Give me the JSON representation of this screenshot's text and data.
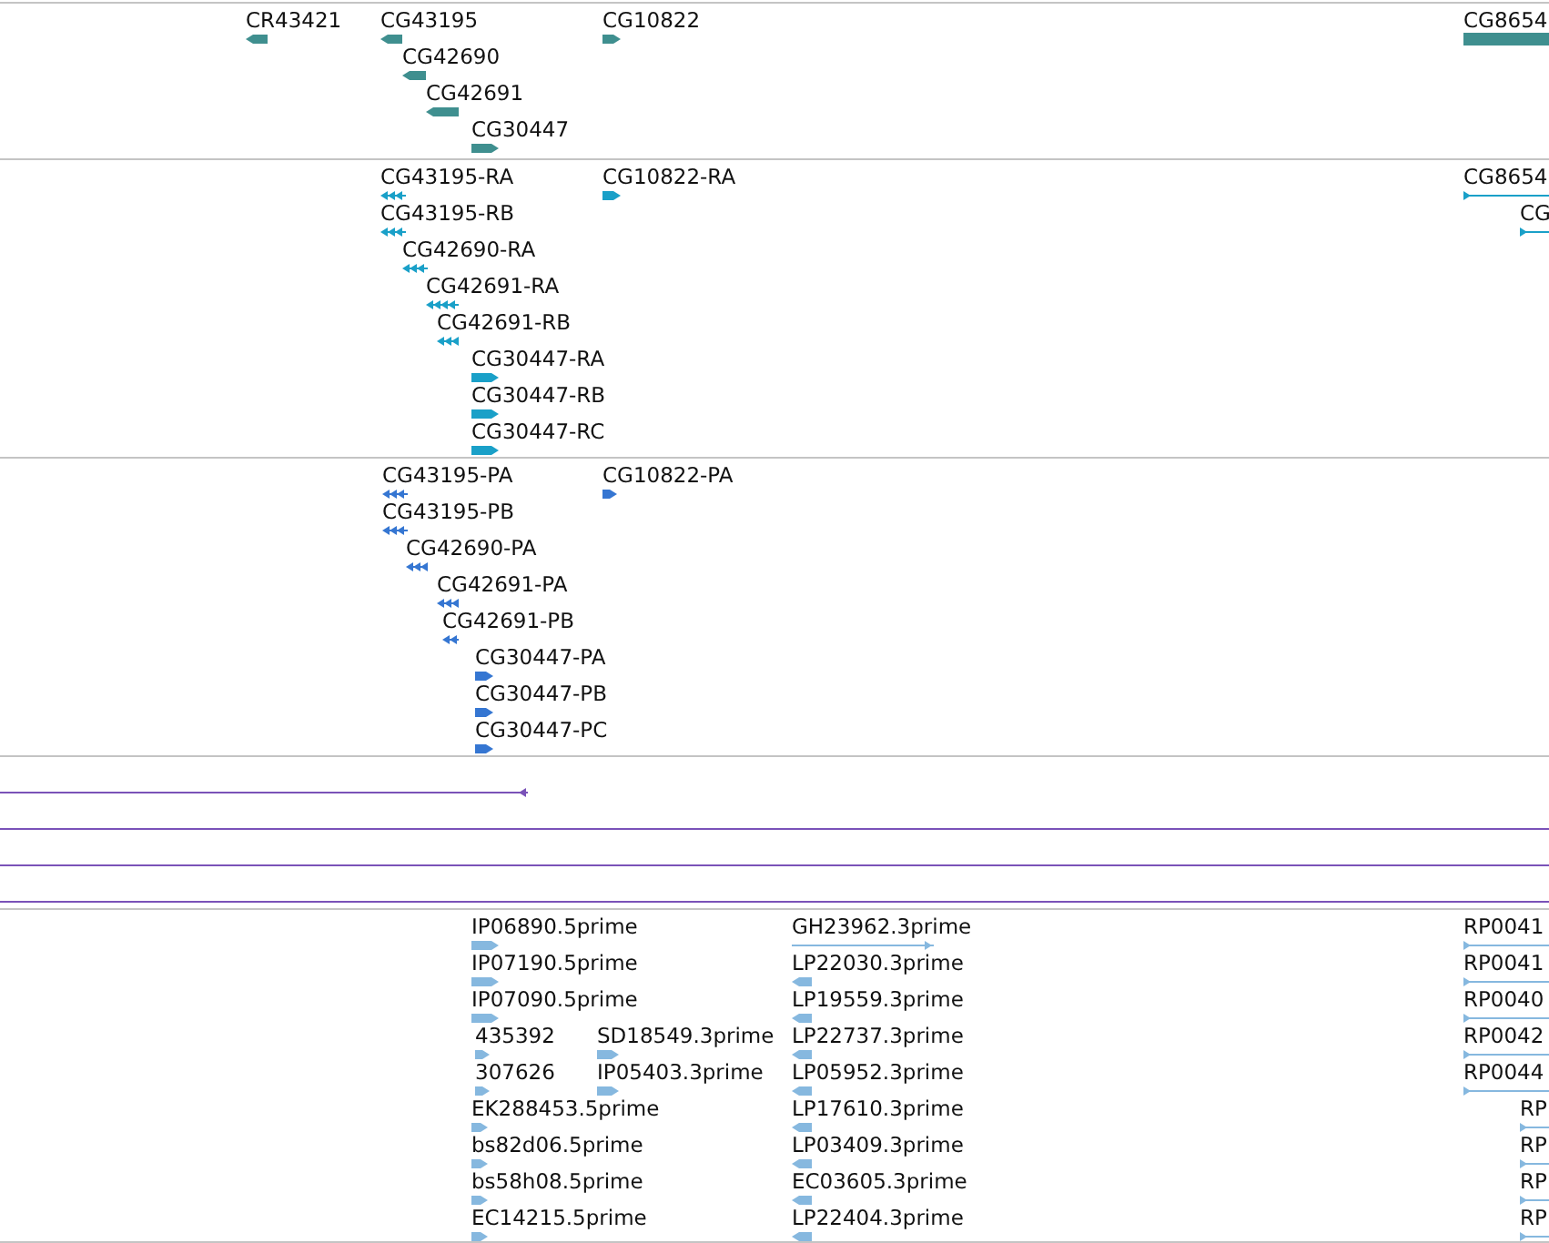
{
  "tracks": [
    {
      "color": "#3f8f8f",
      "features": [
        {
          "label": "CR43421",
          "kind": "block",
          "reverse_strand": true
        },
        {
          "label": "CG43195",
          "kind": "block",
          "reverse_strand": true
        },
        {
          "label": "CG42690",
          "kind": "block",
          "reverse_strand": true
        },
        {
          "label": "CG42691",
          "kind": "block",
          "reverse_strand": true
        },
        {
          "label": "CG30447",
          "kind": "block",
          "reverse_strand": false
        },
        {
          "label": "CG10822",
          "kind": "block",
          "reverse_strand": false
        },
        {
          "label": "CG8654",
          "kind": "block"
        }
      ]
    },
    {
      "color": "#1aa0c8",
      "features": [
        {
          "label": "CG43195-RA",
          "kind": "exons",
          "reverse_strand": true
        },
        {
          "label": "CG43195-RB",
          "kind": "exons",
          "reverse_strand": true
        },
        {
          "label": "CG42690-RA",
          "kind": "exons",
          "reverse_strand": true
        },
        {
          "label": "CG42691-RA",
          "kind": "exons",
          "reverse_strand": true
        },
        {
          "label": "CG42691-RB",
          "kind": "exons",
          "reverse_strand": true
        },
        {
          "label": "CG30447-RA",
          "kind": "block",
          "reverse_strand": false
        },
        {
          "label": "CG30447-RB",
          "kind": "block",
          "reverse_strand": false
        },
        {
          "label": "CG30447-RC",
          "kind": "block",
          "reverse_strand": false
        },
        {
          "label": "CG10822-RA",
          "kind": "block",
          "reverse_strand": false
        },
        {
          "label": "CG8654",
          "kind": "line",
          "reverse_strand": false
        },
        {
          "label": "CG",
          "kind": "line",
          "reverse_strand": false
        }
      ]
    },
    {
      "color": "#3576d2",
      "features": [
        {
          "label": "CG43195-PA",
          "kind": "exons",
          "reverse_strand": true
        },
        {
          "label": "CG43195-PB",
          "kind": "exons",
          "reverse_strand": true
        },
        {
          "label": "CG42690-PA",
          "kind": "exons",
          "reverse_strand": true
        },
        {
          "label": "CG42691-PA",
          "kind": "exons",
          "reverse_strand": true
        },
        {
          "label": "CG42691-PB",
          "kind": "exons",
          "reverse_strand": true
        },
        {
          "label": "CG30447-PA",
          "kind": "block",
          "reverse_strand": false
        },
        {
          "label": "CG30447-PB",
          "kind": "block",
          "reverse_strand": false
        },
        {
          "label": "CG30447-PC",
          "kind": "block",
          "reverse_strand": false
        },
        {
          "label": "CG10822-PA",
          "kind": "block",
          "reverse_strand": false
        }
      ]
    },
    {
      "color": "#7a52b8",
      "features": [
        {
          "kind": "line",
          "reverse_strand": true
        },
        {
          "kind": "line"
        },
        {
          "kind": "line"
        },
        {
          "kind": "line"
        }
      ]
    },
    {
      "color": "#86b8df",
      "features": [
        {
          "label": "IP06890.5prime",
          "kind": "block",
          "reverse_strand": false
        },
        {
          "label": "IP07190.5prime",
          "kind": "block",
          "reverse_strand": false
        },
        {
          "label": "IP07090.5prime",
          "kind": "block",
          "reverse_strand": false
        },
        {
          "label": "435392",
          "kind": "block",
          "reverse_strand": false
        },
        {
          "label": "307626",
          "kind": "block",
          "reverse_strand": false
        },
        {
          "label": "EK288453.5prime",
          "kind": "block",
          "reverse_strand": false
        },
        {
          "label": "bs82d06.5prime",
          "kind": "block",
          "reverse_strand": false
        },
        {
          "label": "bs58h08.5prime",
          "kind": "block",
          "reverse_strand": false
        },
        {
          "label": "EC14215.5prime",
          "kind": "block",
          "reverse_strand": false
        },
        {
          "label": "SD18549.3prime",
          "kind": "block",
          "reverse_strand": false
        },
        {
          "label": "IP05403.3prime",
          "kind": "block",
          "reverse_strand": false
        },
        {
          "label": "GH23962.3prime",
          "kind": "line",
          "reverse_strand": false
        },
        {
          "label": "LP22030.3prime",
          "kind": "block",
          "reverse_strand": true
        },
        {
          "label": "LP19559.3prime",
          "kind": "block",
          "reverse_strand": true
        },
        {
          "label": "LP22737.3prime",
          "kind": "block",
          "reverse_strand": true
        },
        {
          "label": "LP05952.3prime",
          "kind": "block",
          "reverse_strand": true
        },
        {
          "label": "LP17610.3prime",
          "kind": "block",
          "reverse_strand": true
        },
        {
          "label": "LP03409.3prime",
          "kind": "block",
          "reverse_strand": true
        },
        {
          "label": "EC03605.3prime",
          "kind": "block",
          "reverse_strand": true
        },
        {
          "label": "LP22404.3prime",
          "kind": "block",
          "reverse_strand": true
        },
        {
          "label": "RP0041",
          "kind": "line",
          "reverse_strand": false
        },
        {
          "label": "RP0041",
          "kind": "line",
          "reverse_strand": false
        },
        {
          "label": "RP0040",
          "kind": "line",
          "reverse_strand": false
        },
        {
          "label": "RP0042",
          "kind": "line",
          "reverse_strand": false
        },
        {
          "label": "RP0044",
          "kind": "line",
          "reverse_strand": false
        },
        {
          "label": "RP",
          "kind": "line",
          "reverse_strand": false
        },
        {
          "label": "RP",
          "kind": "line",
          "reverse_strand": false
        },
        {
          "label": "RP",
          "kind": "line",
          "reverse_strand": false
        },
        {
          "label": "RP",
          "kind": "line",
          "reverse_strand": false
        }
      ]
    }
  ]
}
